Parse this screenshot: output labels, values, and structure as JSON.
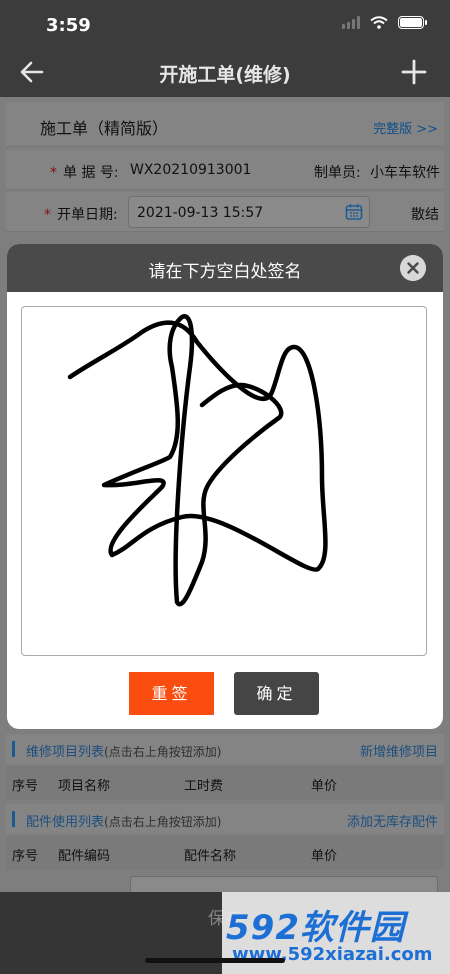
{
  "status": {
    "time": "3:59"
  },
  "nav": {
    "title": "开施工单(维修)"
  },
  "form": {
    "header_title": "施工单（精简版）",
    "header_link": "完整版 >>",
    "doc_no_label": "单 据 号:",
    "doc_no_value": "WX20210913001",
    "maker_label": "制单员:",
    "maker_value": "小车车软件",
    "open_date_label": "开单日期:",
    "open_date_value": "2021-09-13 15:57",
    "settle_label": "散结",
    "repair_section": {
      "title": "维修项目列表",
      "hint": "(点击右上角按钮添加)",
      "link": "新增维修项目"
    },
    "repair_columns": [
      "序号",
      "项目名称",
      "工时费",
      "单价"
    ],
    "parts_section": {
      "title": "配件使用列表",
      "hint": "(点击右上角按钮添加)",
      "link": "添加无库存配件"
    },
    "parts_columns": [
      "序号",
      "配件编码",
      "配件名称",
      "单价"
    ]
  },
  "savebar": {
    "label": "保存"
  },
  "watermark": {
    "logo_num": "592",
    "logo_text": "软件园",
    "url": "www.592xiazai.com"
  },
  "modal": {
    "title": "请在下方空白处签名",
    "reset_label": "重签",
    "confirm_label": "确定"
  },
  "colors": {
    "reset_button": "#fa4d0f",
    "confirm_button": "#454545",
    "header_dark": "#3c3c3c",
    "watermark_blue": "#1d6fd6"
  }
}
